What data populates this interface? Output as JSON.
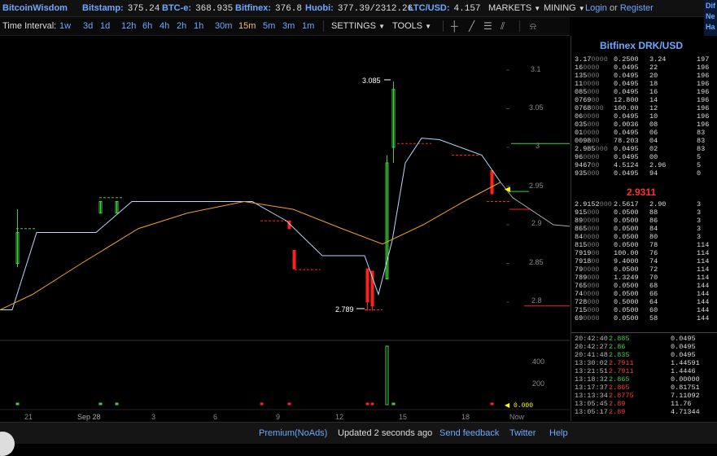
{
  "header": {
    "logo": "BitcoinWisdom",
    "tickers": [
      {
        "exchange": "Bitstamp:",
        "price": "375.24"
      },
      {
        "exchange": "BTC-e:",
        "price": "368.935"
      },
      {
        "exchange": "Bitfinex:",
        "price": "376.8"
      },
      {
        "exchange": "Huobi:",
        "price": "377.39/2312.26"
      },
      {
        "exchange": "LTC/USD:",
        "price": "4.157"
      }
    ],
    "markets": "MARKETS",
    "mining": "MINING",
    "login": "Login",
    "or": "or",
    "register": "Register"
  },
  "side_panel": [
    "Dif",
    "Ne",
    "Ha"
  ],
  "toolbar": {
    "interval_label": "Time Interval:",
    "intervals": [
      "1w",
      "3d",
      "1d",
      "12h",
      "6h",
      "4h",
      "2h",
      "1h",
      "30m",
      "15m",
      "5m",
      "3m",
      "1m"
    ],
    "active_interval": "15m",
    "settings": "SETTINGS",
    "tools": "TOOLS"
  },
  "chart": {
    "y_ticks": [
      "3.1",
      "3.05",
      "3",
      "2.95",
      "2.9",
      "2.85",
      "2.8"
    ],
    "x_ticks": [
      "21",
      "Sep 28",
      "3",
      "6",
      "9",
      "12",
      "15",
      "18",
      "Now"
    ],
    "high_label": "3.085",
    "low_label": "2.789",
    "vol_ticks": [
      "400",
      "200"
    ],
    "vol_current": "0.000",
    "colors": {
      "up": "#3ad43a",
      "down": "#ff2020",
      "ma_fast": "#b8d8ff",
      "ma_slow": "#f0a030"
    }
  },
  "chart_data": {
    "type": "candlestick",
    "title": "",
    "ylim": [
      2.77,
      3.12
    ],
    "yticks": [
      2.8,
      2.85,
      2.9,
      2.95,
      3.0,
      3.05,
      3.1
    ],
    "xticks": [
      "21",
      "Sep 28",
      "3",
      "6",
      "9",
      "12",
      "15",
      "18",
      "Now"
    ],
    "high": 3.085,
    "low": 2.789,
    "last": 2.9311,
    "volume_ticks": [
      200,
      400
    ]
  },
  "orderbook": {
    "title": "Bitfinex DRK/USD",
    "asks": [
      {
        "price": "3.17",
        "dim": "0000",
        "amount": "0.2500",
        "sum": "3.24",
        "cum": "197"
      },
      {
        "price": "16",
        "dim": "0000",
        "amount": "0.0495",
        "sum": "22",
        "cum": "196"
      },
      {
        "price": "135",
        "dim": "000",
        "amount": "0.0495",
        "sum": "20",
        "cum": "196"
      },
      {
        "price": "11",
        "dim": "0000",
        "amount": "0.0495",
        "sum": "18",
        "cum": "196"
      },
      {
        "price": "085",
        "dim": "000",
        "amount": "0.0495",
        "sum": "16",
        "cum": "196"
      },
      {
        "price": "0769",
        "dim": "00",
        "amount": "12.800",
        "sum": "14",
        "cum": "196"
      },
      {
        "price": "0768",
        "dim": "000",
        "amount": "100.00",
        "sum": "12",
        "cum": "196"
      },
      {
        "price": "06",
        "dim": "0000",
        "amount": "0.0495",
        "sum": "10",
        "cum": "196"
      },
      {
        "price": "035",
        "dim": "000",
        "amount": "0.0036",
        "sum": "08",
        "cum": "196"
      },
      {
        "price": "01",
        "dim": "0000",
        "amount": "0.0495",
        "sum": "06",
        "cum": "83"
      },
      {
        "price": "0098",
        "dim": "00",
        "amount": "78.203",
        "sum": "04",
        "cum": "83"
      },
      {
        "price": "2.985",
        "dim": "000",
        "amount": "0.0495",
        "sum": "02",
        "cum": "83"
      },
      {
        "price": "96",
        "dim": "0000",
        "amount": "0.0495",
        "sum": "00",
        "cum": "5"
      },
      {
        "price": "9467",
        "dim": "00",
        "amount": "4.5124",
        "sum": "2.96",
        "cum": "5"
      },
      {
        "price": "935",
        "dim": "000",
        "amount": "0.0495",
        "sum": "94",
        "cum": "0"
      }
    ],
    "mid_price": "2.9311",
    "bids": [
      {
        "price": "2.9152",
        "dim": "000",
        "amount": "2.5617",
        "sum": "2.90",
        "cum": "3"
      },
      {
        "price": "915",
        "dim": "000",
        "amount": "0.0500",
        "sum": "88",
        "cum": "3"
      },
      {
        "price": "89",
        "dim": "0000",
        "amount": "0.0500",
        "sum": "86",
        "cum": "3"
      },
      {
        "price": "865",
        "dim": "000",
        "amount": "0.0500",
        "sum": "84",
        "cum": "3"
      },
      {
        "price": "84",
        "dim": "0000",
        "amount": "0.0500",
        "sum": "80",
        "cum": "3"
      },
      {
        "price": "815",
        "dim": "000",
        "amount": "0.0500",
        "sum": "78",
        "cum": "114"
      },
      {
        "price": "7919",
        "dim": "00",
        "amount": "100.00",
        "sum": "76",
        "cum": "114"
      },
      {
        "price": "7918",
        "dim": "00",
        "amount": "9.4000",
        "sum": "74",
        "cum": "114"
      },
      {
        "price": "79",
        "dim": "0000",
        "amount": "0.0500",
        "sum": "72",
        "cum": "114"
      },
      {
        "price": "789",
        "dim": "000",
        "amount": "1.3249",
        "sum": "70",
        "cum": "114"
      },
      {
        "price": "765",
        "dim": "000",
        "amount": "0.0500",
        "sum": "68",
        "cum": "144"
      },
      {
        "price": "74",
        "dim": "0000",
        "amount": "0.0500",
        "sum": "66",
        "cum": "144"
      },
      {
        "price": "728",
        "dim": "000",
        "amount": "0.5000",
        "sum": "64",
        "cum": "144"
      },
      {
        "price": "715",
        "dim": "000",
        "amount": "0.0500",
        "sum": "60",
        "cum": "144"
      },
      {
        "price": "69",
        "dim": "0000",
        "amount": "0.0500",
        "sum": "58",
        "cum": "144"
      }
    ]
  },
  "trades": [
    {
      "time": "20:42:40",
      "price": "2.885",
      "dir": "up",
      "amount": "0.0495"
    },
    {
      "time": "20:42:27",
      "price": "2.86",
      "dir": "up",
      "amount": "0.0495"
    },
    {
      "time": "20:41:48",
      "price": "2.835",
      "dir": "up",
      "amount": "0.0495"
    },
    {
      "time": "13:30:02",
      "price": "2.7911",
      "dir": "dn",
      "amount": "1.44591"
    },
    {
      "time": "13:21:51",
      "price": "2.7911",
      "dir": "dn",
      "amount": "1.4446"
    },
    {
      "time": "13:18:32",
      "price": "2.865",
      "dir": "up",
      "amount": "0.00000"
    },
    {
      "time": "13:17:37",
      "price": "2.865",
      "dir": "dn",
      "amount": "0.81751"
    },
    {
      "time": "13:13:34",
      "price": "2.8775",
      "dir": "dn",
      "amount": "7.11092"
    },
    {
      "time": "13:05:45",
      "price": "2.89",
      "dir": "dn",
      "amount": "11.76"
    },
    {
      "time": "13:05:17",
      "price": "2.89",
      "dir": "dn",
      "amount": "4.71344"
    }
  ],
  "footer": {
    "premium": "Premium(NoAds)",
    "updated": "Updated 2 seconds ago",
    "feedback": "Send feedback",
    "twitter": "Twitter",
    "help": "Help"
  }
}
